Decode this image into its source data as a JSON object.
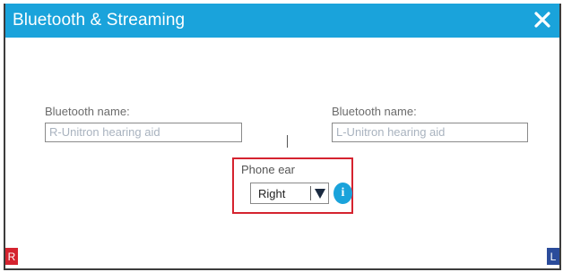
{
  "window": {
    "title": "Bluetooth & Streaming",
    "accent_color": "#1aa3db"
  },
  "right_aid": {
    "name_label": "Bluetooth name:",
    "name_value": "R-Unitron hearing aid",
    "badge": "R",
    "badge_color": "#d5232f"
  },
  "left_aid": {
    "name_label": "Bluetooth name:",
    "name_value": "L-Unitron hearing aid",
    "badge": "L",
    "badge_color": "#2b4c9b"
  },
  "phone_ear": {
    "label": "Phone ear",
    "selected": "Right",
    "highlight_color": "#d5232f",
    "info_icon": "info-icon",
    "info_glyph": "i"
  },
  "icons": {
    "close": "close-icon",
    "dropdown": "triangle-down-icon"
  }
}
